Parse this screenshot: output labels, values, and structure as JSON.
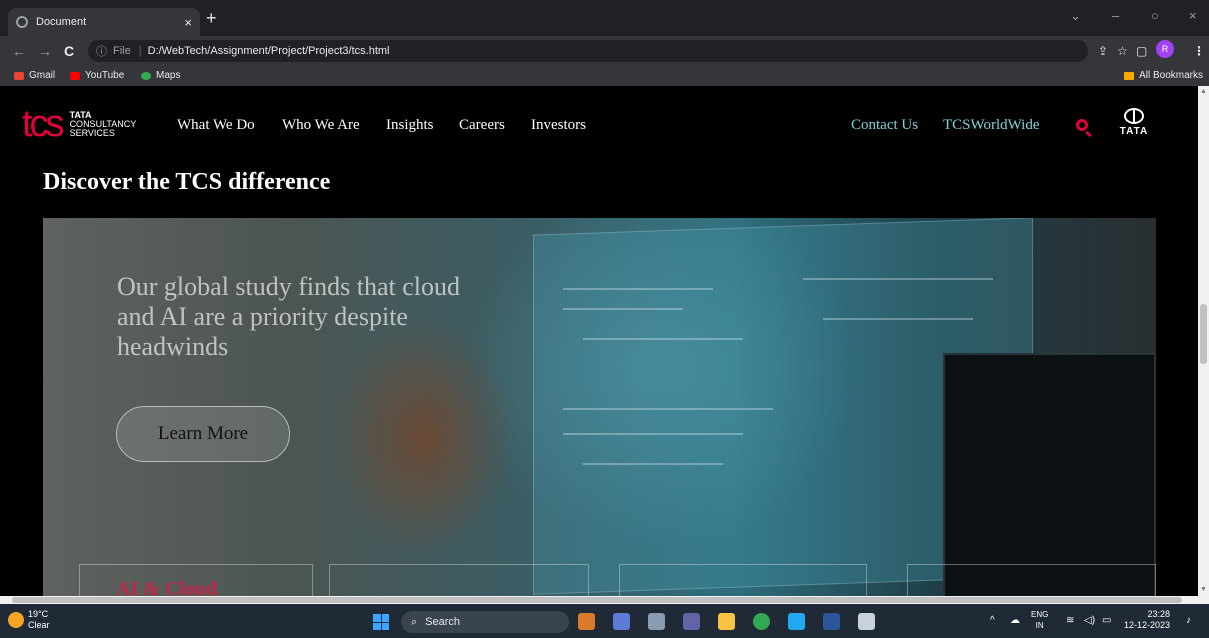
{
  "browser": {
    "tab_title": "Document",
    "tab_close": "×",
    "new_tab": "+",
    "back": "←",
    "forward": "→",
    "reload": "C",
    "info_icon": "ⓘ",
    "url_label": "File",
    "url": "D:/WebTech/Assignment/Project/Project3/tcs.html",
    "profile_initial": "R",
    "bookmarks": [
      "Gmail",
      "YouTube",
      "Maps"
    ],
    "all_bookmarks": "All Bookmarks",
    "window_controls": [
      "⌄",
      "–",
      "○",
      "×"
    ],
    "toolbar_icons": [
      "⇪",
      "☆",
      "▢",
      "⋮"
    ]
  },
  "site": {
    "logo_mark": "tcs",
    "logo_line1": "TATA",
    "logo_line2": "CONSULTANCY",
    "logo_line3": "SERVICES",
    "nav": [
      "What We Do",
      "Who We Are",
      "Insights",
      "Careers",
      "Investors"
    ],
    "nav_right": [
      "Contact Us",
      "TCSWorldWide"
    ],
    "tata_word": "TATA",
    "accent_color": "#e4003b",
    "link_color": "#7fd3dc",
    "section_title": "Discover the TCS difference",
    "hero_headline": "Our global study finds that cloud and AI are a priority despite headwinds",
    "learn_more": "Learn More",
    "card_title": "AI & Cloud"
  },
  "taskbar": {
    "temp": "19°C",
    "weather": "Clear",
    "search": "Search",
    "tray_up": "^",
    "lang_top": "ENG",
    "lang_bottom": "IN",
    "time": "23:28",
    "date": "12-12-2023"
  }
}
